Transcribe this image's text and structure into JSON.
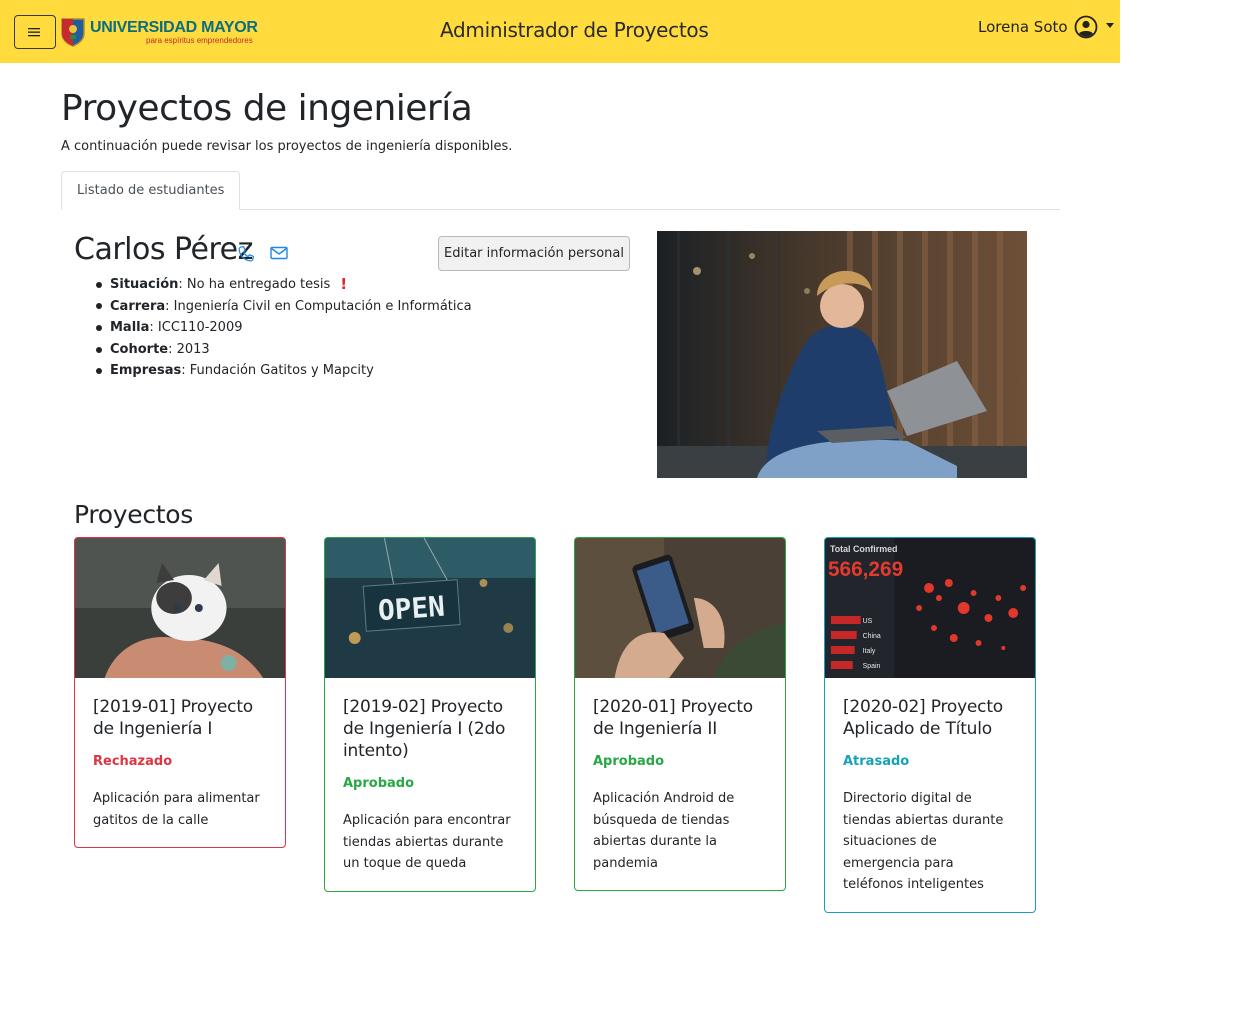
{
  "navbar": {
    "logo_main": "UNIVERSIDAD MAYOR",
    "logo_sub": "para espíritus emprendedores",
    "app_title": "Administrador de Proyectos",
    "user_name": "Lorena Soto"
  },
  "page": {
    "title": "Proyectos de ingeniería",
    "subtitle": "A continuación puede revisar los proyectos de ingeniería disponibles.",
    "tabs": [
      {
        "label": "Listado de estudiantes"
      }
    ]
  },
  "student": {
    "name": "Carlos Pérez",
    "edit_label": "Editar información personal",
    "fields": [
      {
        "label": "Situación",
        "value": ": No ha entregado tesis",
        "warning": "!"
      },
      {
        "label": "Carrera",
        "value": ": Ingeniería Civil en Computación e Informática"
      },
      {
        "label": "Malla",
        "value": ": ICC110-2009"
      },
      {
        "label": "Cohorte",
        "value": ": 2013"
      },
      {
        "label": "Empresas",
        "value": ": Fundación Gatitos y Mapcity"
      }
    ]
  },
  "projects": {
    "title": "Proyectos",
    "cards": [
      {
        "title": "[2019-01] Proyecto de Ingeniería I",
        "status": "Rechazado",
        "status_color": "#dc3545",
        "description": "Aplicación para alimentar gatitos de la calle",
        "image": "kitten"
      },
      {
        "title": "[2019-02] Proyecto de Ingeniería I (2do intento)",
        "status": "Aprobado",
        "status_color": "#28a745",
        "description": "Aplicación para encontrar tiendas abiertas durante un toque de queda",
        "image": "open-sign",
        "sign_text": "OPEN"
      },
      {
        "title": "[2020-01] Proyecto de Ingeniería II",
        "status": "Aprobado",
        "status_color": "#28a745",
        "description": "Aplicación Android de búsqueda de tiendas abiertas durante la pandemia",
        "image": "phone-in-hands"
      },
      {
        "title": "[2020-02] Proyecto Aplicado de Título",
        "status": "Atrasado",
        "status_color": "#17a2b8",
        "description": "Directorio digital de tiendas abiertas durante situaciones de emergencia para teléfonos inteligentes",
        "image": "covid-dashboard",
        "dash_label": "Total Confirmed",
        "dash_value": "566,269",
        "dash_rows": [
          "US",
          "China",
          "Italy",
          "Spain"
        ]
      }
    ]
  },
  "colors": {
    "navbar": "#ffdb3d",
    "icon_blue": "#1e88e5",
    "warning": "#e0243a"
  }
}
